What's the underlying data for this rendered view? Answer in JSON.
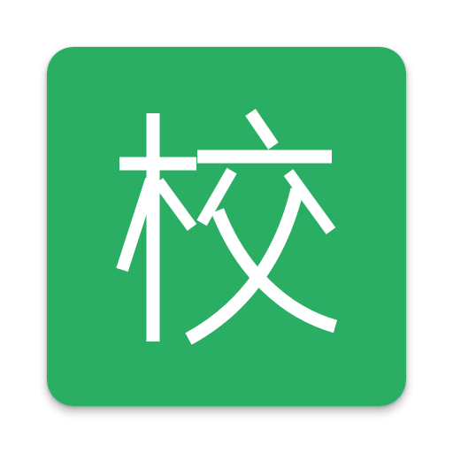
{
  "app_icon": {
    "character": "校",
    "background_color": "#2aae63",
    "glyph_color": "#ffffff",
    "icon_name": "xiao-character-app-icon"
  }
}
